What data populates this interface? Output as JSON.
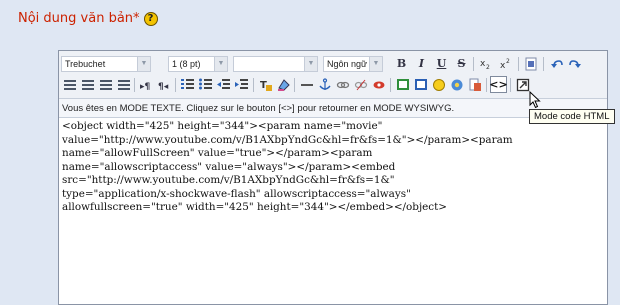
{
  "field": {
    "label": "Nội dung văn bản*",
    "help_icon": "help-icon",
    "help_glyph": "?"
  },
  "toolbar": {
    "font_family": "Trebuchet",
    "font_size": "1 (8 pt)",
    "heading": "",
    "language": "Ngôn ngữ",
    "icons": {
      "bold": "B",
      "italic": "I",
      "underline": "U",
      "strikethrough": "S",
      "html_code": "<>"
    }
  },
  "notice": "Vous êtes en MODE TEXTE. Cliquez sur le bouton [<>] pour retourner en MODE WYSIWYG.",
  "editor": {
    "content": "<object width=\"425\" height=\"344\"><param name=\"movie\"\nvalue=\"http://www.youtube.com/v/B1AXbpYndGc&hl=fr&fs=1&\"></param><param\nname=\"allowFullScreen\" value=\"true\"></param><param\nname=\"allowscriptaccess\" value=\"always\"></param><embed\nsrc=\"http://www.youtube.com/v/B1AXbpYndGc&hl=fr&fs=1&\"\ntype=\"application/x-shockwave-flash\" allowscriptaccess=\"always\"\nallowfullscreen=\"true\" width=\"425\" height=\"344\"></embed></object>"
  },
  "tooltip": "Mode code HTML"
}
